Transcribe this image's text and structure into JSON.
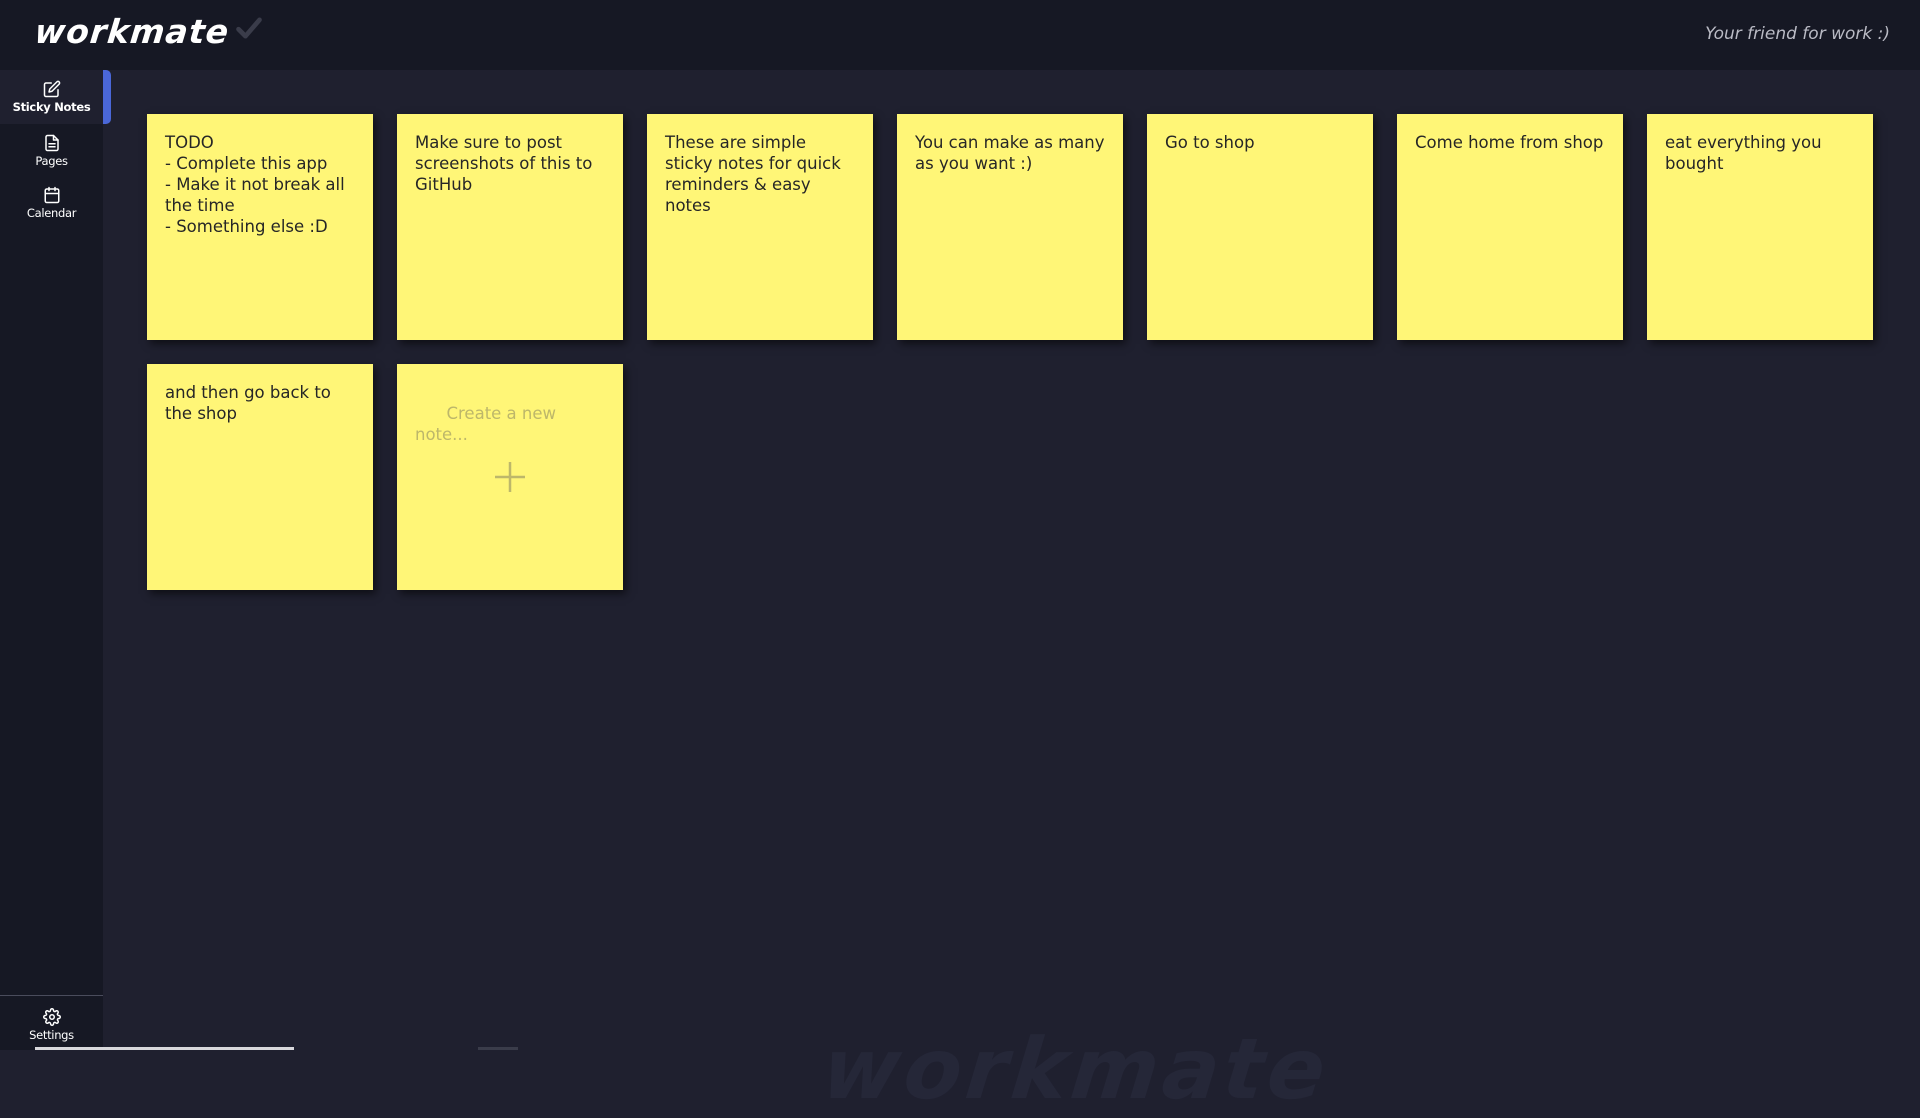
{
  "app": {
    "logo_text": "workmate",
    "tagline": "Your friend for work :)",
    "watermark": "workmate"
  },
  "sidebar": {
    "items": [
      {
        "label": "Sticky Notes",
        "icon": "edit-icon",
        "active": true
      },
      {
        "label": "Pages",
        "icon": "file-icon",
        "active": false
      },
      {
        "label": "Calendar",
        "icon": "calendar-icon",
        "active": false
      }
    ],
    "settings": {
      "label": "Settings",
      "icon": "gear-icon"
    }
  },
  "notes": [
    {
      "text": "TODO\n- Complete this app\n- Make it not break all the time\n- Something else :D"
    },
    {
      "text": "Make sure to post screenshots of this to GitHub"
    },
    {
      "text": "These are simple sticky notes for quick reminders & easy notes"
    },
    {
      "text": "You can make as many as you want :)"
    },
    {
      "text": "Go to shop"
    },
    {
      "text": "Come home from shop"
    },
    {
      "text": "eat everything you bought"
    },
    {
      "text": "and then go back to the shop"
    }
  ],
  "new_note": {
    "placeholder": "Create a new note...",
    "icon": "plus-icon"
  },
  "colors": {
    "background": "#1f202f",
    "sidebar": "#161824",
    "accent": "#4a67d8",
    "note": "#fff677",
    "note_text": "#262626"
  }
}
